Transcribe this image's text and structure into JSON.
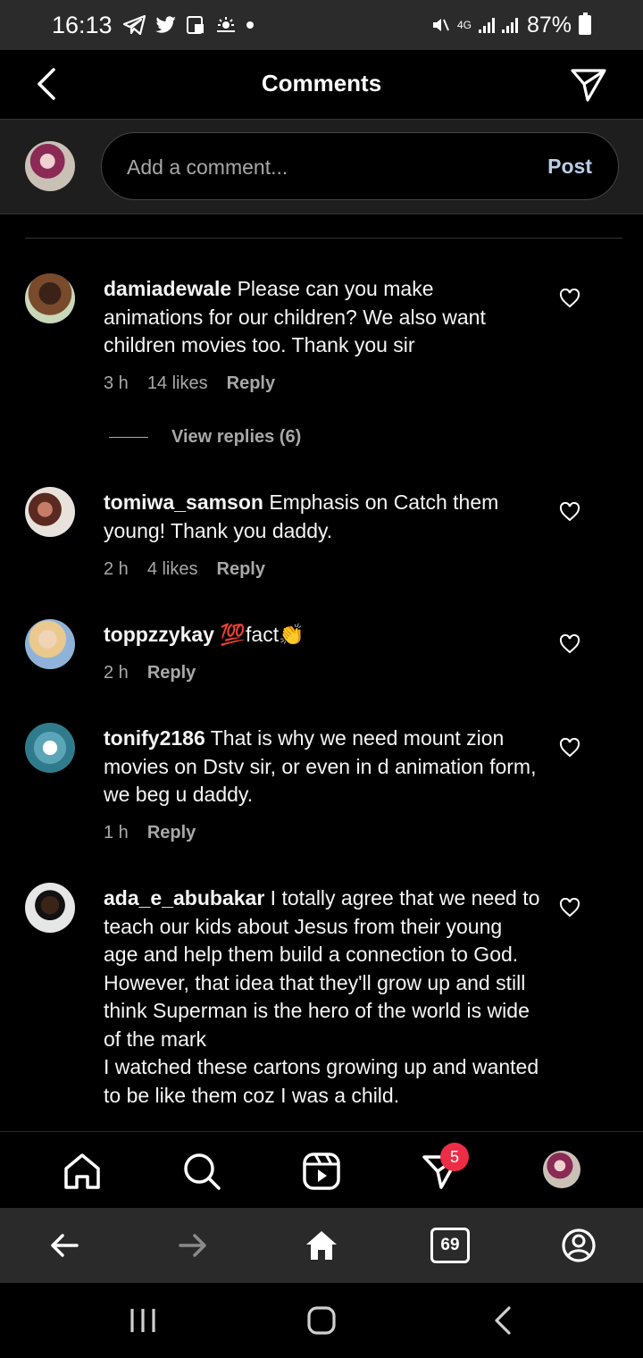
{
  "status_bar": {
    "time": "16:13",
    "battery": "87%",
    "network": "4G"
  },
  "header": {
    "title": "Comments"
  },
  "comment_input": {
    "placeholder": "Add a comment...",
    "post_label": "Post"
  },
  "comments": [
    {
      "username": "damiadewale",
      "text": " Please can you make animations for our children? We also want children movies too. Thank you sir",
      "time": "3 h",
      "likes": "14 likes",
      "reply": "Reply"
    },
    {
      "username": "tomiwa_samson",
      "text": " Emphasis on Catch them young! Thank you daddy.",
      "time": "2 h",
      "likes": "4 likes",
      "reply": "Reply"
    },
    {
      "username": "toppzzykay",
      "text": " 💯fact👏",
      "time": "2 h",
      "reply": "Reply"
    },
    {
      "username": "tonify2186",
      "text": " That is why we need mount zion movies on Dstv sir, or even in d animation form, we beg u daddy.",
      "time": "1 h",
      "reply": "Reply"
    },
    {
      "username": "ada_e_abubakar",
      "text": " I totally agree that we need to teach our kids about Jesus from their young age and help them build a connection to God.",
      "text2": "However, that idea that they'll grow up and still think Superman is the hero of the world is wide of the mark",
      "text3": "I watched these cartons growing up and wanted to be like them coz I was a child."
    }
  ],
  "view_replies": "View replies (6)",
  "bottom_nav": {
    "badge": "5"
  },
  "browser_bar": {
    "tabs_count": "69"
  },
  "icons": [
    "back-arrow-icon",
    "send-icon",
    "heart-icon",
    "home-icon",
    "search-icon",
    "reels-icon",
    "activity-icon",
    "tabs-icon",
    "account-icon"
  ]
}
